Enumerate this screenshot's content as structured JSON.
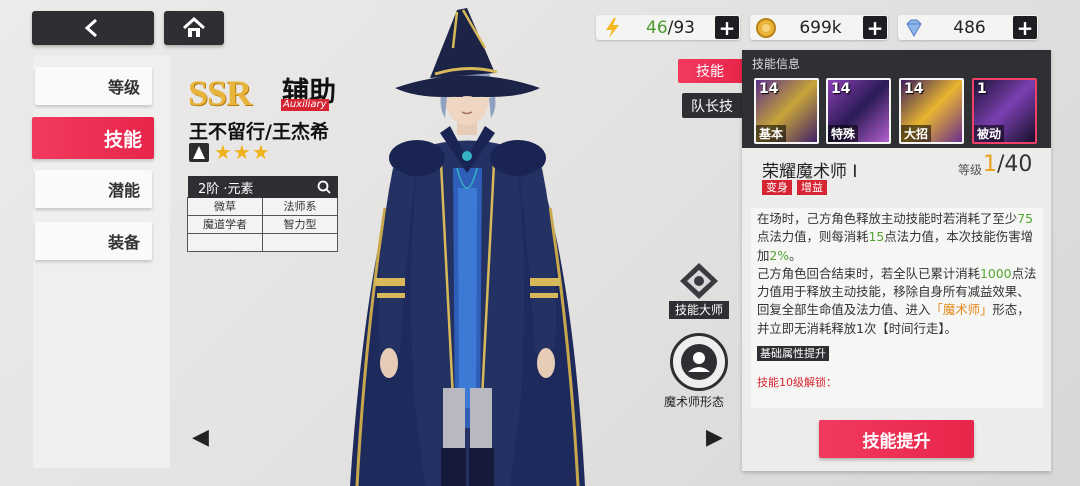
{
  "resources": [
    {
      "icon": "energy-icon",
      "current": "46",
      "max": "/93"
    },
    {
      "icon": "gold-coin-icon",
      "value": "699k"
    },
    {
      "icon": "diamond-icon",
      "value": "486"
    }
  ],
  "left_menu": [
    "等级",
    "技能",
    "潜能",
    "装备"
  ],
  "character": {
    "rarity": "SSR",
    "role_cn": "辅助",
    "role_en": "Auxiliary",
    "name": "王不留行/王杰希",
    "stars": "★★★",
    "grade_header": "2阶 ·元素",
    "tags": [
      [
        "微草",
        "法师系"
      ],
      [
        "魔道学者",
        "智力型"
      ],
      [
        "",
        ""
      ]
    ]
  },
  "tabs": {
    "skill": "技能",
    "leader_skill": "队长技"
  },
  "side": {
    "skill_master": "技能大师",
    "magician_form": "魔术师形态"
  },
  "panel": {
    "title": "技能信息",
    "skills": [
      {
        "level": "14",
        "name": "基本"
      },
      {
        "level": "14",
        "name": "特殊"
      },
      {
        "level": "14",
        "name": "大招"
      },
      {
        "level": "1",
        "name": "被动"
      }
    ],
    "skill_name": "荣耀魔术师 I",
    "level_label": "等级",
    "level_current": "1",
    "level_max": "/40",
    "tags": [
      "变身",
      "增益"
    ],
    "desc": {
      "p1a": "在场时，己方角色释放主动技能时若消耗了至少",
      "n1": "75",
      "p1b": "点法力值，则每消耗",
      "n2": "15",
      "p1c": "点法力值，本次技能伤害增加",
      "n3": "2%",
      "p1d": "。",
      "p2a": "己方角色回合结束时，若全队已累计消耗",
      "n4": "1000",
      "p2b": "点法力值用于释放主动技能，移除自身所有减益效果、回复全部生命值及法力值、进入",
      "form": "「魔术师」",
      "p2c": "形态，并立即无消耗释放1次【时间行走】。"
    },
    "base_attr": "基础属性提升",
    "unlock": "技能10级解锁：",
    "upgrade": "技能提升"
  },
  "colors": {
    "accent": "#e8254b",
    "dark": "#2e2f33",
    "gold": "#e9a21c",
    "green": "#56a632"
  }
}
